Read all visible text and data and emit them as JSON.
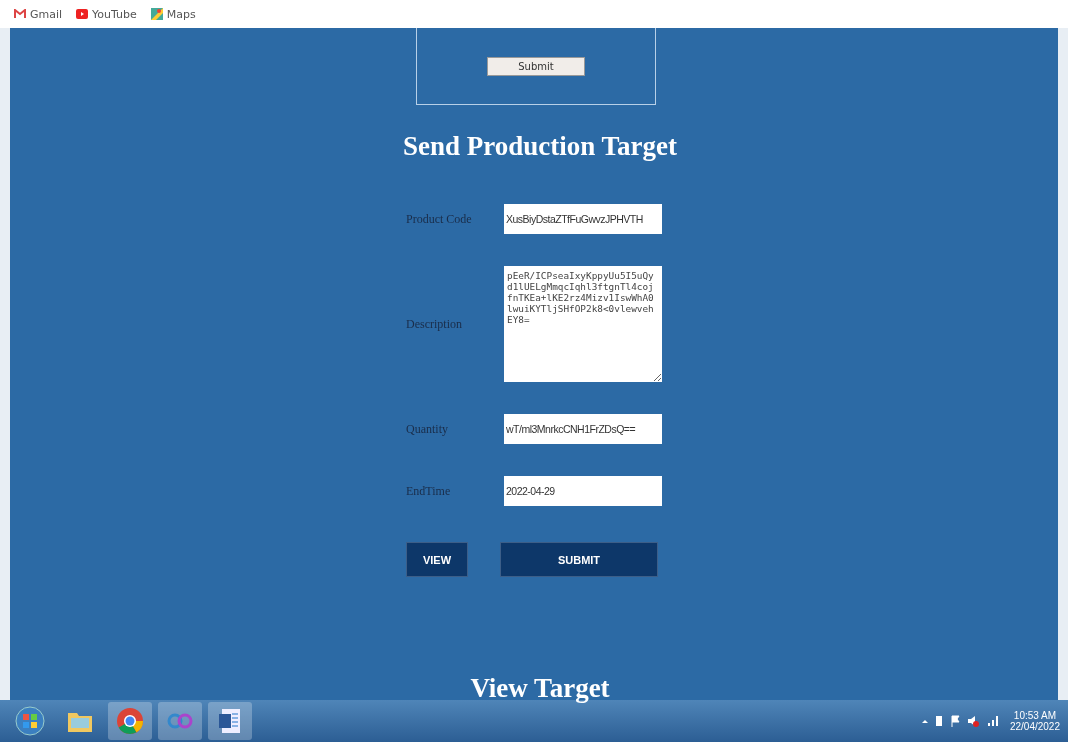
{
  "bookmarks": [
    {
      "label": "Gmail",
      "kind": "gmail"
    },
    {
      "label": "YouTube",
      "kind": "youtube"
    },
    {
      "label": "Maps",
      "kind": "maps"
    }
  ],
  "top_form": {
    "button": "Submit"
  },
  "send_target": {
    "title": "Send Production Target",
    "fields": [
      {
        "label": "Product Code",
        "kind": "input",
        "value": "XusBiyDstaZTfFuGwvzJPHVTH"
      },
      {
        "label": "Description",
        "kind": "textarea",
        "value": "pEeR/ICPseaIxyKppyUu5I5uQyd1lUELgMmqcIqhl3ftgnTl4cojfnTKEa+lKE2rz4Mizv1IswWhA0lwuiKYTljSHfOP2k8<0vlewvehEY8="
      },
      {
        "label": "Quantity",
        "kind": "input",
        "value": "wT/ml3MnrkcCNH1FrZDsQ=="
      },
      {
        "label": "EndTime",
        "kind": "input",
        "value": "2022-04-29"
      }
    ],
    "buttons": [
      "VIEW",
      "SUBMIT"
    ]
  },
  "view_target": {
    "title": "View Target"
  },
  "taskbar": {
    "apps": [
      {
        "kind": "start"
      },
      {
        "kind": "folder"
      },
      {
        "kind": "chrome"
      },
      {
        "kind": "loop"
      },
      {
        "kind": "word"
      }
    ],
    "time": "10:53 AM",
    "date": "22/04/2022"
  }
}
